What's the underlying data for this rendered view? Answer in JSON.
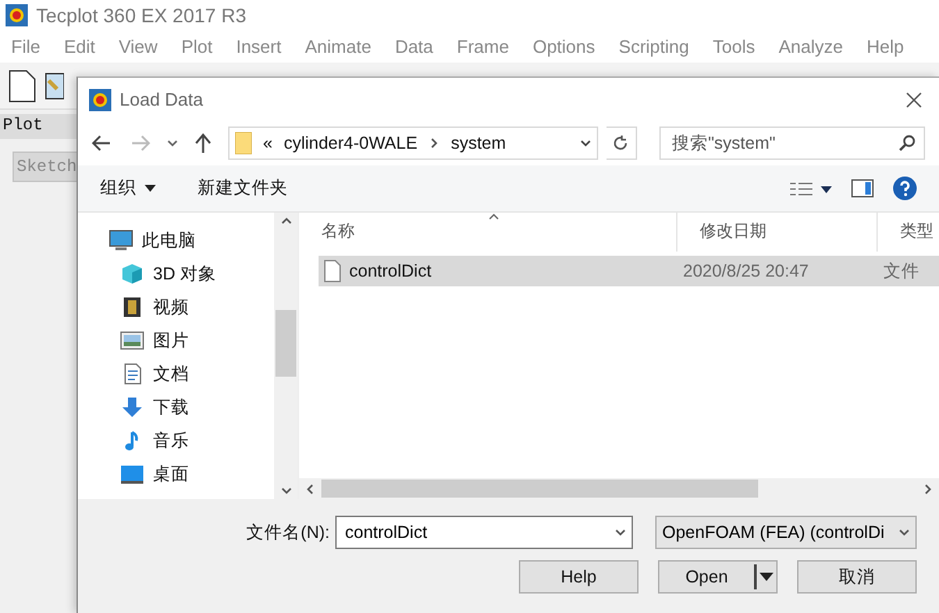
{
  "app": {
    "title": "Tecplot 360 EX 2017 R3",
    "menu": [
      "File",
      "Edit",
      "View",
      "Plot",
      "Insert",
      "Animate",
      "Data",
      "Frame",
      "Options",
      "Scripting",
      "Tools",
      "Analyze",
      "Help"
    ]
  },
  "side_panel": {
    "title": "Plot",
    "button": "Sketch"
  },
  "dialog": {
    "title": "Load Data",
    "breadcrumb": {
      "overflow": "«",
      "folders": [
        "cylinder4-0WALE",
        "system"
      ]
    },
    "search": {
      "placeholder": "搜索\"system\""
    },
    "toolbar": {
      "organize": "组织",
      "new_folder": "新建文件夹"
    },
    "nav": [
      {
        "label": "此电脑",
        "kind": "computer",
        "children": [
          {
            "label": "3D 对象",
            "kind": "cube"
          },
          {
            "label": "视频",
            "kind": "film"
          },
          {
            "label": "图片",
            "kind": "image"
          },
          {
            "label": "文档",
            "kind": "document"
          },
          {
            "label": "下载",
            "kind": "download"
          },
          {
            "label": "音乐",
            "kind": "music"
          },
          {
            "label": "桌面",
            "kind": "desktop"
          }
        ]
      }
    ],
    "columns": [
      "名称",
      "修改日期",
      "类型"
    ],
    "rows": [
      {
        "name": "controlDict",
        "date": "2020/8/25 20:47",
        "type": "文件",
        "selected": true
      }
    ],
    "filename_label": "文件名(N):",
    "filename": "controlDict",
    "filter": "OpenFOAM (FEA) (controlDi",
    "buttons": [
      "Help",
      "Open",
      "取消"
    ]
  }
}
